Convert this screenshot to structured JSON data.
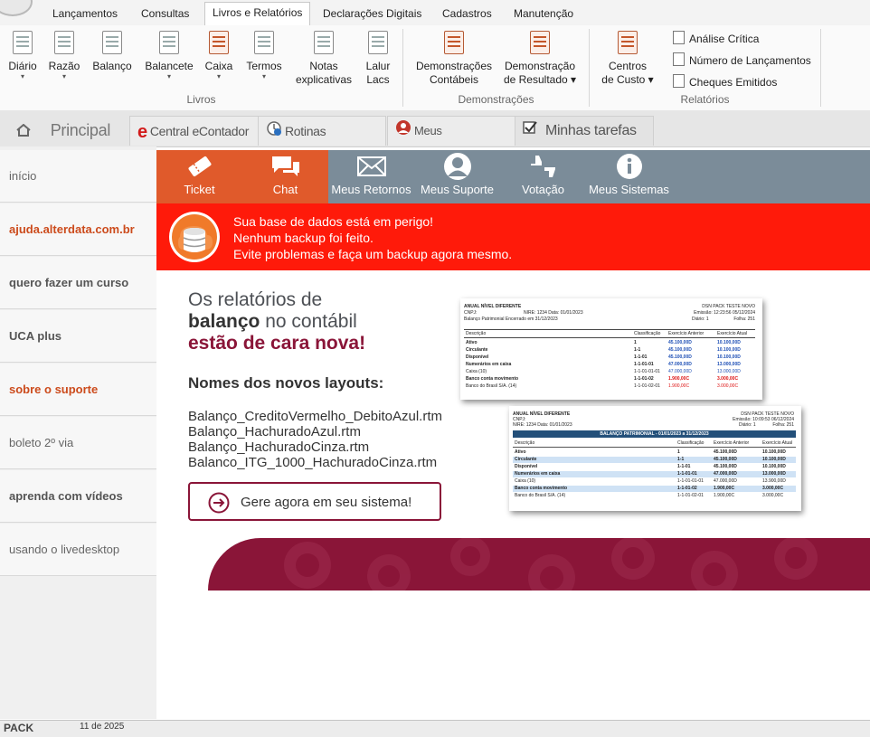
{
  "menu": {
    "tabs": [
      "Lançamentos",
      "Consultas",
      "Livros e Relatórios",
      "Declarações Digitais",
      "Cadastros",
      "Manutenção"
    ],
    "active_tab": "Livros e Relatórios"
  },
  "ribbon": {
    "livros": {
      "group_label": "Livros",
      "buttons": [
        {
          "line1": "Diário",
          "line2": "▾"
        },
        {
          "line1": "Razão",
          "line2": "▾"
        },
        {
          "line1": "Balanço",
          "line2": ""
        },
        {
          "line1": "Balancete",
          "line2": "▾"
        },
        {
          "line1": "Caixa",
          "line2": "▾"
        },
        {
          "line1": "Termos",
          "line2": "▾"
        },
        {
          "line1": "Notas",
          "line2": "explicativas"
        },
        {
          "line1": "Lalur",
          "line2": "Lacs"
        }
      ]
    },
    "demonstracoes": {
      "group_label": "Demonstrações",
      "buttons": [
        {
          "line1": "Demonstrações",
          "line2": "Contábeis"
        },
        {
          "line1": "Demonstração",
          "line2": "de Resultado ▾"
        }
      ]
    },
    "relatorios": {
      "group_label": "Relatórios",
      "centros": {
        "line1": "Centros",
        "line2": "de Custo ▾"
      },
      "small": [
        "Análise Crítica",
        "Número de Lançamentos",
        "Cheques Emitidos"
      ]
    }
  },
  "page_tabs": [
    "Principal",
    "Central eContador",
    "Rotinas automáticas",
    "Meus Atendimentos",
    "Minhas tarefas"
  ],
  "sidebar": {
    "items": [
      "início",
      "ajuda.alterdata.com.br",
      "quero fazer um curso",
      "UCA plus",
      "sobre o suporte",
      "boleto 2º via",
      "aprenda com vídeos",
      "usando o livedesktop"
    ]
  },
  "iconbar": {
    "items": [
      "Ticket",
      "Chat",
      "Meus Retornos",
      "Meus Suporte",
      "Votação",
      "Meus Sistemas"
    ]
  },
  "alert": {
    "line1": "Sua base de dados está em perigo!",
    "line2": "Nenhum backup foi feito.",
    "line3": "Evite problemas e faça um backup agora mesmo."
  },
  "promo": {
    "line1": "Os relatórios de",
    "line2_bold": "balanço",
    "line2_rest": " no contábil",
    "line3": "estão de cara nova!",
    "layouts_title": "Nomes dos novos layouts:",
    "layouts": [
      "Balanço_CreditoVermelho_DebitoAzul.rtm",
      "Balanço_HachuradoAzul.rtm",
      "Balanço_HachuradoCinza.rtm",
      "Balanco_ITG_1000_HachuradoCinza.rtm"
    ],
    "button": "Gere agora em seu sistema!"
  },
  "doc1": {
    "company": "ANUAL NÍVEL DIFERENTE",
    "sys": "DSN PACK TESTE NOVO",
    "cnpj": "CNPJ:",
    "nire": "NIRE: 1234 Data: 01/01/2023",
    "emissao": "Emissão: 12:23:56 05/12/2024",
    "encerrado": "Balanço Patrimonial Encerrado em 31/12/2023",
    "diario": "Diário: 1",
    "folha": "Folha: 251",
    "headers": [
      "Descrição",
      "Classificação",
      "Exercício Anterior",
      "Exercício Atual"
    ],
    "rows": [
      [
        "Ativo",
        "1",
        "45.100,00D",
        "10.100,00D"
      ],
      [
        "Circulante",
        "1-1",
        "45.100,00D",
        "10.100,00D"
      ],
      [
        "Disponível",
        "1-1-01",
        "45.100,00D",
        "10.100,00D"
      ],
      [
        "Numerários em caixa",
        "1-1-01-01",
        "47.000,00D",
        "13.000,00D"
      ],
      [
        "Caixa (10)",
        "1-1-01-01-01",
        "47.000,00D",
        "13.000,00D"
      ],
      [
        "Banco conta movimento",
        "1-1-01-02",
        "1.900,00C",
        "3.000,00C"
      ],
      [
        "Banco do Brasil S/A. (14)",
        "1-1-01-02-01",
        "1.900,00C",
        "3.000,00C"
      ]
    ]
  },
  "doc2": {
    "company": "ANUAL NÍVEL DIFERENTE",
    "sys": "DSN PACK TESTE NOVO",
    "cnpj": "CNPJ:",
    "nire": "NIRE: 1234 Data: 01/01/2023",
    "emissao": "Emissão: 10:09:53 06/12/2024",
    "diario": "Diário: 1",
    "folha": "Folha: 251",
    "banner": "BALANÇO PATRIMONIAL - 01/01/2023 a 31/12/2023",
    "headers": [
      "Descrição",
      "Classificação",
      "Exercício Anterior",
      "Exercício Atual"
    ],
    "rows": [
      [
        "Ativo",
        "1",
        "45.100,00D",
        "10.100,00D"
      ],
      [
        "Circulante",
        "1-1",
        "45.100,00D",
        "10.100,00D"
      ],
      [
        "Disponível",
        "1-1-01",
        "45.100,00D",
        "10.100,00D"
      ],
      [
        "Numerários em caixa",
        "1-1-01-01",
        "47.000,00D",
        "13.000,00D"
      ],
      [
        "Caixa (10)",
        "1-1-01-01-01",
        "47.000,00D",
        "13.900,00D"
      ],
      [
        "Banco conta movimento",
        "1-1-01-02",
        "1.900,00C",
        "3.000,00C"
      ],
      [
        "Banco do Brasil S/A. (14)",
        "1-1-01-02-01",
        "1.900,00C",
        "3.000,00C"
      ]
    ]
  },
  "statusbar": {
    "left": "PACK",
    "date": "11 de 2025"
  },
  "colors": {
    "accent": "#e05a2b",
    "maroon": "#8a1538",
    "alert": "#ff1a0a",
    "iconbar": "#7b8c99"
  }
}
